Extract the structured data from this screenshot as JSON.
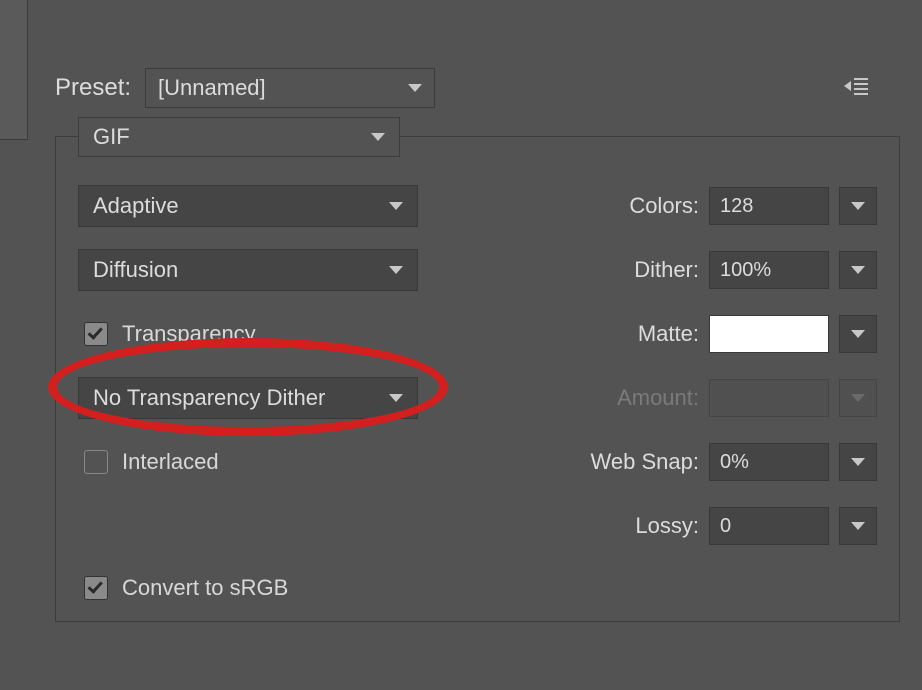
{
  "preset": {
    "label": "Preset:",
    "value": "[Unnamed]"
  },
  "format": {
    "value": "GIF"
  },
  "left": {
    "reduction": "Adaptive",
    "dither_method": "Diffusion",
    "transparency_label": "Transparency",
    "trans_dither": "No Transparency Dither",
    "interlaced_label": "Interlaced"
  },
  "right": {
    "colors_label": "Colors:",
    "colors_value": "128",
    "dither_label": "Dither:",
    "dither_value": "100%",
    "matte_label": "Matte:",
    "amount_label": "Amount:",
    "amount_value": "",
    "websnap_label": "Web Snap:",
    "websnap_value": "0%",
    "lossy_label": "Lossy:",
    "lossy_value": "0"
  },
  "convert_srgb_label": "Convert to sRGB"
}
